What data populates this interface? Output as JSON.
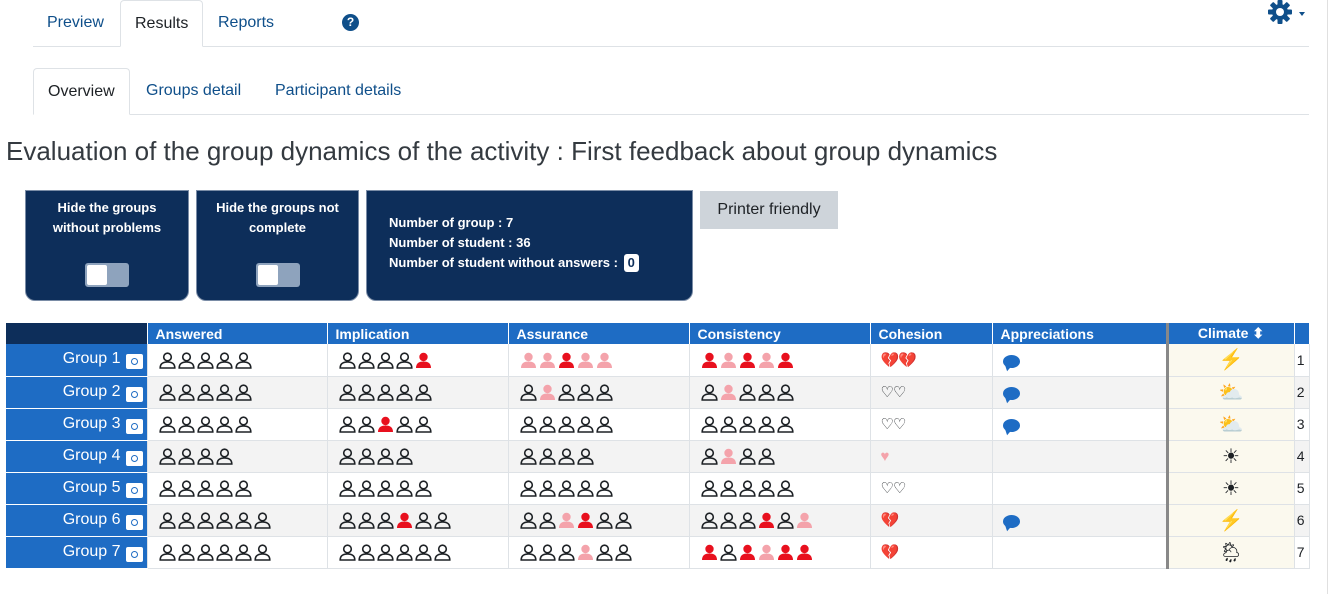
{
  "top_tabs": [
    {
      "label": "Preview"
    },
    {
      "label": "Results"
    },
    {
      "label": "Reports"
    }
  ],
  "help_icon": "question-circle-icon",
  "settings_icon": "gear-icon",
  "sub_tabs": [
    {
      "label": "Overview"
    },
    {
      "label": "Groups detail"
    },
    {
      "label": "Participant details"
    }
  ],
  "page_title": "Evaluation of the group dynamics of the activity : First feedback about group dynamics",
  "filters": {
    "hide_no_problems": {
      "line1": "Hide the groups",
      "line2": "without problems",
      "enabled": false
    },
    "hide_not_complete": {
      "line1": "Hide the groups not",
      "line2": "complete",
      "enabled": false
    }
  },
  "stats": {
    "groups_label": "Number of group : 7",
    "students_label": "Number of student : 36",
    "without_answers_label": "Number of student without answers :",
    "without_answers_value": "0"
  },
  "printer_label": "Printer friendly",
  "colors": {
    "navy": "#0d2e5a",
    "blue": "#1e6cc4",
    "red": "#e8101e",
    "pink": "#f4a3ab",
    "gray": "#1d2125"
  },
  "table": {
    "headers": [
      "Answered",
      "Implication",
      "Assurance",
      "Consistency",
      "Cohesion",
      "Appreciations",
      "Climate ⬍"
    ],
    "rows": [
      {
        "group": "Group 1",
        "answered": "ooooo",
        "implication": "ooooR",
        "assurance": "PPRPP",
        "consistency": "RPRPR",
        "cohesion": "broken2",
        "appreciation": true,
        "climate": "storm-icon",
        "num": "1"
      },
      {
        "group": "Group 2",
        "answered": "ooooo",
        "implication": "ooooo",
        "assurance": "oPooo",
        "consistency": "oPooo",
        "cohesion": "empty2",
        "appreciation": true,
        "climate": "sun-cloud-icon",
        "num": "2"
      },
      {
        "group": "Group 3",
        "answered": "ooooo",
        "implication": "ooRoo",
        "assurance": "ooooo",
        "consistency": "ooooo",
        "cohesion": "empty2",
        "appreciation": true,
        "climate": "sun-cloud-icon",
        "num": "3"
      },
      {
        "group": "Group 4",
        "answered": "oooo",
        "implication": "oooo",
        "assurance": "oooo",
        "consistency": "oPoo",
        "cohesion": "pink1",
        "appreciation": false,
        "climate": "sun-icon",
        "num": "4"
      },
      {
        "group": "Group 5",
        "answered": "ooooo",
        "implication": "ooooo",
        "assurance": "ooooo",
        "consistency": "ooooo",
        "cohesion": "empty2",
        "appreciation": false,
        "climate": "sun-icon",
        "num": "5"
      },
      {
        "group": "Group 6",
        "answered": "oooooo",
        "implication": "oooRoo",
        "assurance": "ooPRoo",
        "consistency": "oooRoP",
        "cohesion": "broken1",
        "appreciation": true,
        "climate": "storm-icon",
        "num": "6"
      },
      {
        "group": "Group 7",
        "answered": "oooooo",
        "implication": "oooooo",
        "assurance": "oooPoo",
        "consistency": "RoRPRR",
        "cohesion": "broken1",
        "appreciation": false,
        "climate": "rain-icon",
        "num": "7"
      }
    ]
  }
}
